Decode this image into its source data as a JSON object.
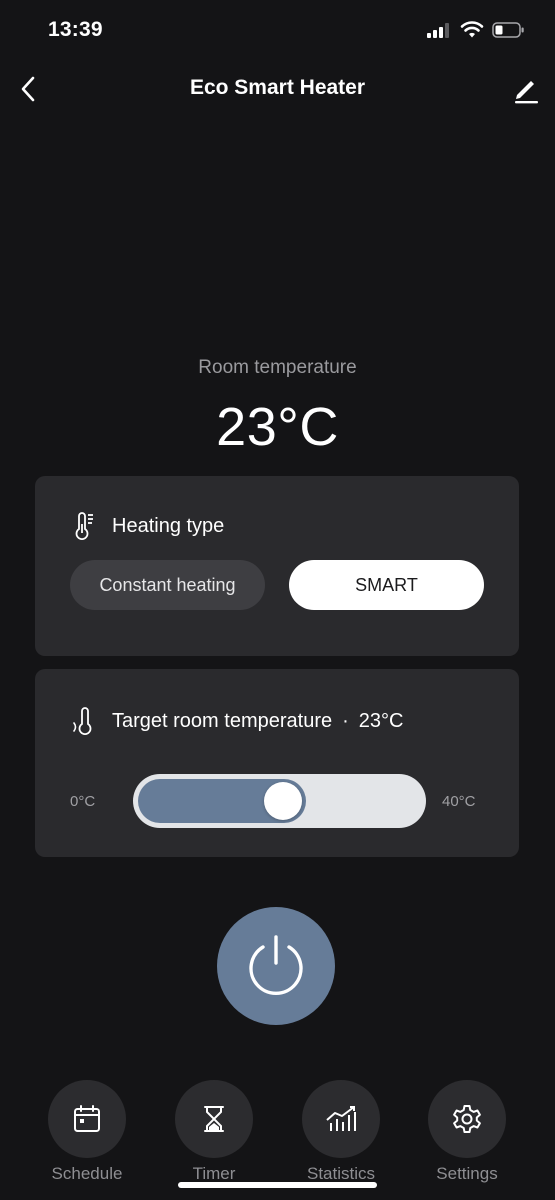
{
  "status_bar": {
    "time": "13:39"
  },
  "nav": {
    "title": "Eco Smart Heater"
  },
  "room": {
    "label": "Room temperature",
    "value": "23°C"
  },
  "heating_type": {
    "title": "Heating type",
    "options": [
      "Constant heating",
      "SMART"
    ],
    "selected": "SMART"
  },
  "target": {
    "title": "Target room temperature",
    "separator": "·",
    "value": "23°C",
    "min_label": "0°C",
    "max_label": "40°C",
    "slider_fraction": 0.575
  },
  "tabs": {
    "schedule": "Schedule",
    "timer": "Timer",
    "statistics": "Statistics",
    "settings": "Settings"
  },
  "colors": {
    "background": "#141416",
    "card": "#2a2a2d",
    "accent": "#667c98",
    "muted_text": "#9a9a9e"
  },
  "icons": {
    "back": "chevron-left-icon",
    "edit": "pencil-icon",
    "heating_type": "thermometer-icon",
    "target": "thermometer-icon",
    "power": "power-icon",
    "schedule": "calendar-icon",
    "timer": "hourglass-icon",
    "statistics": "chart-icon",
    "settings": "gear-icon"
  }
}
